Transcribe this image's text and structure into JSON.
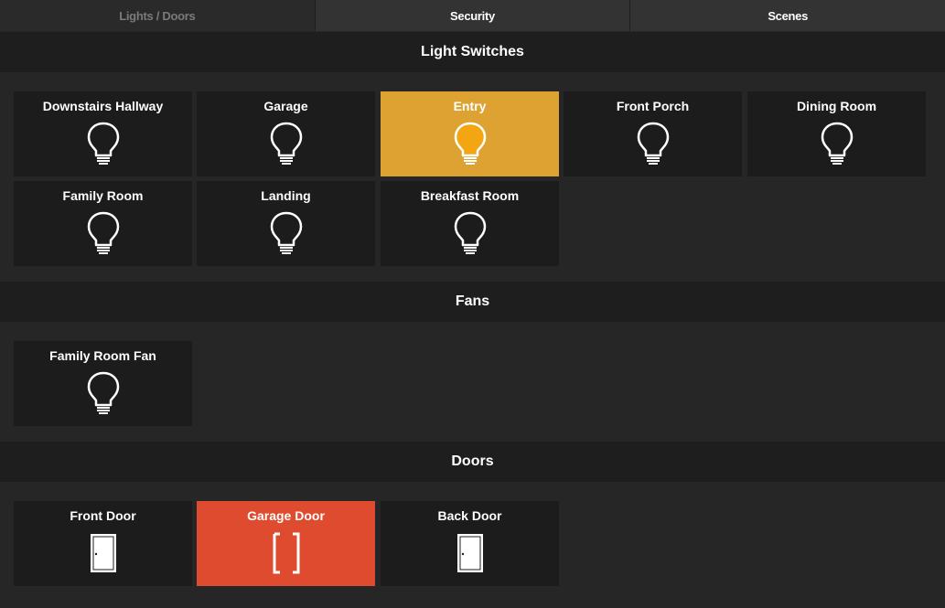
{
  "tabs": [
    {
      "label": "Lights / Doors",
      "active": true
    },
    {
      "label": "Security",
      "active": false
    },
    {
      "label": "Scenes",
      "active": false
    }
  ],
  "sections": {
    "lights": {
      "title": "Light Switches",
      "tiles": [
        {
          "label": "Downstairs Hallway",
          "state": "off",
          "icon": "bulb-icon"
        },
        {
          "label": "Garage",
          "state": "off",
          "icon": "bulb-icon"
        },
        {
          "label": "Entry",
          "state": "on",
          "icon": "bulb-icon"
        },
        {
          "label": "Front Porch",
          "state": "off",
          "icon": "bulb-icon"
        },
        {
          "label": "Dining Room",
          "state": "off",
          "icon": "bulb-icon"
        },
        {
          "label": "Family Room",
          "state": "off",
          "icon": "bulb-icon"
        },
        {
          "label": "Landing",
          "state": "off",
          "icon": "bulb-icon"
        },
        {
          "label": "Breakfast Room",
          "state": "off",
          "icon": "bulb-icon"
        }
      ]
    },
    "fans": {
      "title": "Fans",
      "tiles": [
        {
          "label": "Family Room Fan",
          "state": "off",
          "icon": "bulb-icon"
        }
      ]
    },
    "doors": {
      "title": "Doors",
      "tiles": [
        {
          "label": "Front Door",
          "state": "closed",
          "icon": "door-closed-icon"
        },
        {
          "label": "Garage Door",
          "state": "open",
          "icon": "door-open-icon"
        },
        {
          "label": "Back Door",
          "state": "closed",
          "icon": "door-closed-icon"
        }
      ]
    }
  },
  "colors": {
    "background": "#262626",
    "header": "#1e1e1e",
    "tile": "#1c1c1c",
    "light_on": "#dda232",
    "bulb_on": "#f3a612",
    "door_open": "#df4b2e"
  }
}
